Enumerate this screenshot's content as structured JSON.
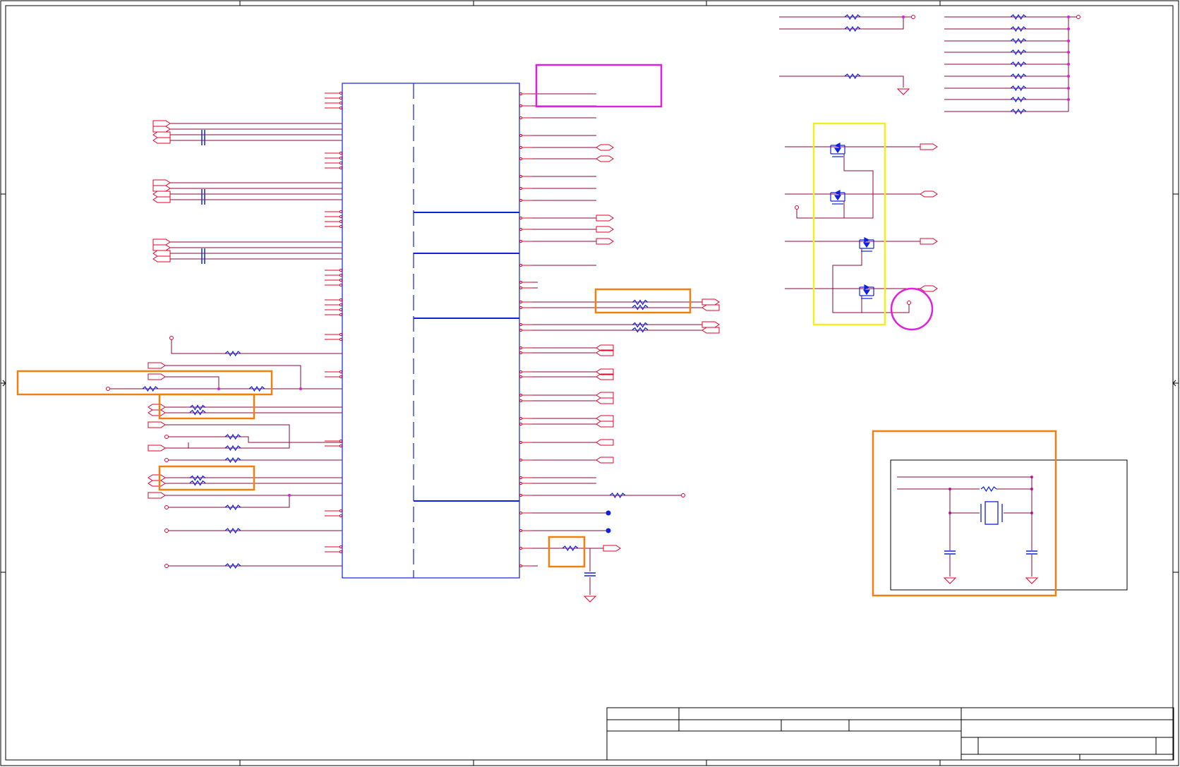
{
  "sheet": {
    "zone_columns": 5,
    "zone_rows": 4
  },
  "title_block": {
    "title": "",
    "document_number": "",
    "revision": "",
    "date": "",
    "sheet": ""
  },
  "colors": {
    "border": "#000000",
    "wire": "#8b0a3c",
    "net": "#e8002a",
    "component": "#1020e0",
    "junction": "#d81fd8",
    "highlight_orange": "#f08010",
    "highlight_magenta": "#e020e0",
    "highlight_yellow": "#f0f020"
  },
  "components": {
    "main_ic": "ic-symbol",
    "crystal_block": "crystal-oscillator",
    "mosfet_array": "mosfet",
    "resistor": "resistor",
    "capacitor": "capacitor",
    "ground": "ground-symbol"
  }
}
